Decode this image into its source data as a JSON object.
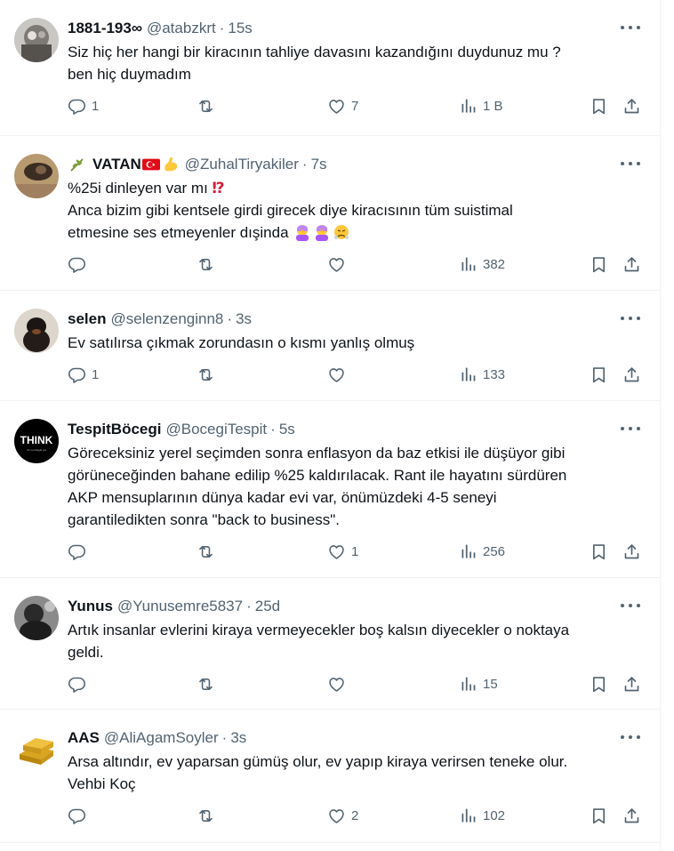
{
  "tweets": [
    {
      "name": "1881-193∞",
      "handle": "@atabzkrt",
      "time": "15s",
      "text": "Siz hiç her hangi bir kiracının tahliye davasını kazandığını duydunuz mu ?\nben hiç duymadım",
      "replies": "1",
      "retweets": "",
      "likes": "7",
      "views": "1 B"
    },
    {
      "name": "VATAN",
      "handle": "@ZuhalTiryakiler",
      "time": "7s",
      "text_line1": "%25i dinleyen var mı ",
      "text_bang": "⁉",
      "text_rest": "Anca bizim gibi kentsele girdi girecek diye kiracısının tüm suistimal\netmesine ses etmeyenler dışinda ",
      "replies": "",
      "retweets": "",
      "likes": "",
      "views": "382"
    },
    {
      "name": "selen",
      "handle": "@selenzenginn8",
      "time": "3s",
      "text": "Ev satılırsa çıkmak zorundasın o kısmı yanlış olmuş",
      "replies": "1",
      "retweets": "",
      "likes": "",
      "views": "133"
    },
    {
      "name": "TespitBöcegi",
      "handle": "@BocegiTespit",
      "time": "5s",
      "avatar_text": "THINK",
      "avatar_sub": "it's not illegal yet",
      "text": "Göreceksiniz yerel seçimden sonra enflasyon da baz etkisi ile düşüyor gibi\ngörüneceğinden bahane edilip %25 kaldırılacak. Rant ile hayatını sürdüren\nAKP mensuplarının dünya kadar evi var, önümüzdeki 4-5 seneyi\ngarantiledikten sonra \"back to business\".",
      "replies": "",
      "retweets": "",
      "likes": "1",
      "views": "256"
    },
    {
      "name": "Yunus",
      "handle": "@Yunusemre5837",
      "time": "25d",
      "text": "Artık insanlar evlerini kiraya vermeyecekler boş kalsın diyecekler o noktaya\ngeldi.",
      "replies": "",
      "retweets": "",
      "likes": "",
      "views": "15"
    },
    {
      "name": "AAS",
      "handle": "@AliAgamSoyler",
      "time": "3s",
      "text": "Arsa altındır, ev yaparsan gümüş olur, ev yapıp kiraya verirsen teneke olur.\nVehbi Koç",
      "replies": "",
      "retweets": "",
      "likes": "2",
      "views": "102"
    }
  ],
  "separator": "·",
  "icons": {
    "reply": "reply-icon",
    "retweet": "retweet-icon",
    "like": "heart-icon",
    "views": "views-icon",
    "bookmark": "bookmark-icon",
    "share": "share-icon",
    "more": "more-icon"
  },
  "colors": {
    "text": "#0f1419",
    "secondary": "#536471",
    "border": "#eff3f4"
  }
}
